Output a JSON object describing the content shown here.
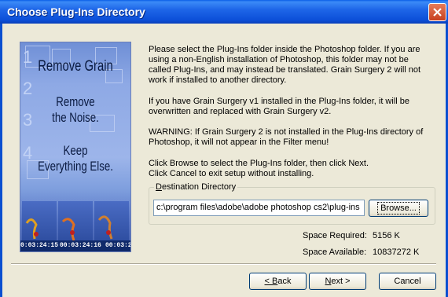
{
  "window": {
    "title": "Choose Plug-Ins Directory"
  },
  "banner": {
    "numbers": [
      "1",
      "2",
      "3",
      "4"
    ],
    "heading": "Remove Grain",
    "lines": [
      "Remove",
      "the Noise.",
      "Keep",
      "Everything Else."
    ],
    "timecodes": [
      "0:03:24:15",
      "00:03:24:16",
      "00:03:2"
    ]
  },
  "instructions": {
    "p1": "Please select the Plug-Ins folder inside the Photoshop folder.  If you are using a non-English installation of Photoshop, this folder may not be called Plug-Ins, and may instead be translated.  Grain Surgery 2 will not work if installed to another directory.",
    "p2": "If you have Grain Surgery v1 installed in the Plug-Ins folder, it will be overwritten and replaced with Grain Surgery v2.",
    "p3": "WARNING: If Grain Surgery 2 is not installed in the Plug-Ins directory of Photoshop, it will not appear in the Filter menu!",
    "p4a": "Click Browse to select the Plug-Ins folder, then click Next.",
    "p4b": "Click Cancel to exit setup without installing."
  },
  "destination": {
    "label_key": "D",
    "label_rest": "estination Directory",
    "path": "c:\\program files\\adobe\\adobe photoshop cs2\\plug-ins",
    "browse_label": "Browse..."
  },
  "space": {
    "required_label": "Space Required:",
    "required_value": "5156 K",
    "available_label": "Space Available:",
    "available_value": "10837272 K"
  },
  "buttons": {
    "back_key": "< B",
    "back_rest": "ack",
    "next_key": "N",
    "next_rest": "ext >",
    "cancel": "Cancel"
  },
  "colors": {
    "titlebar": "#0a5fe8",
    "dialog_bg": "#ece9d8",
    "close": "#c8401f"
  }
}
